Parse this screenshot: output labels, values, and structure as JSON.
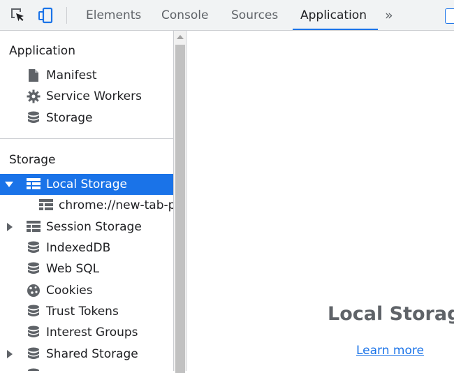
{
  "toolbar": {
    "tabs": [
      {
        "label": "Elements"
      },
      {
        "label": "Console"
      },
      {
        "label": "Sources"
      },
      {
        "label": "Application"
      }
    ],
    "more_label": "»"
  },
  "sidebar": {
    "application_section": {
      "title": "Application",
      "items": [
        {
          "label": "Manifest"
        },
        {
          "label": "Service Workers"
        },
        {
          "label": "Storage"
        }
      ]
    },
    "storage_section": {
      "title": "Storage",
      "items": [
        {
          "label": "Local Storage"
        },
        {
          "label": "chrome://new-tab-p"
        },
        {
          "label": "Session Storage"
        },
        {
          "label": "IndexedDB"
        },
        {
          "label": "Web SQL"
        },
        {
          "label": "Cookies"
        },
        {
          "label": "Trust Tokens"
        },
        {
          "label": "Interest Groups"
        },
        {
          "label": "Shared Storage"
        }
      ]
    }
  },
  "main": {
    "title": "Local Storage",
    "learn_more": "Learn more"
  },
  "colors": {
    "accent": "#1a73e8",
    "selected_text": "#ffffff"
  }
}
